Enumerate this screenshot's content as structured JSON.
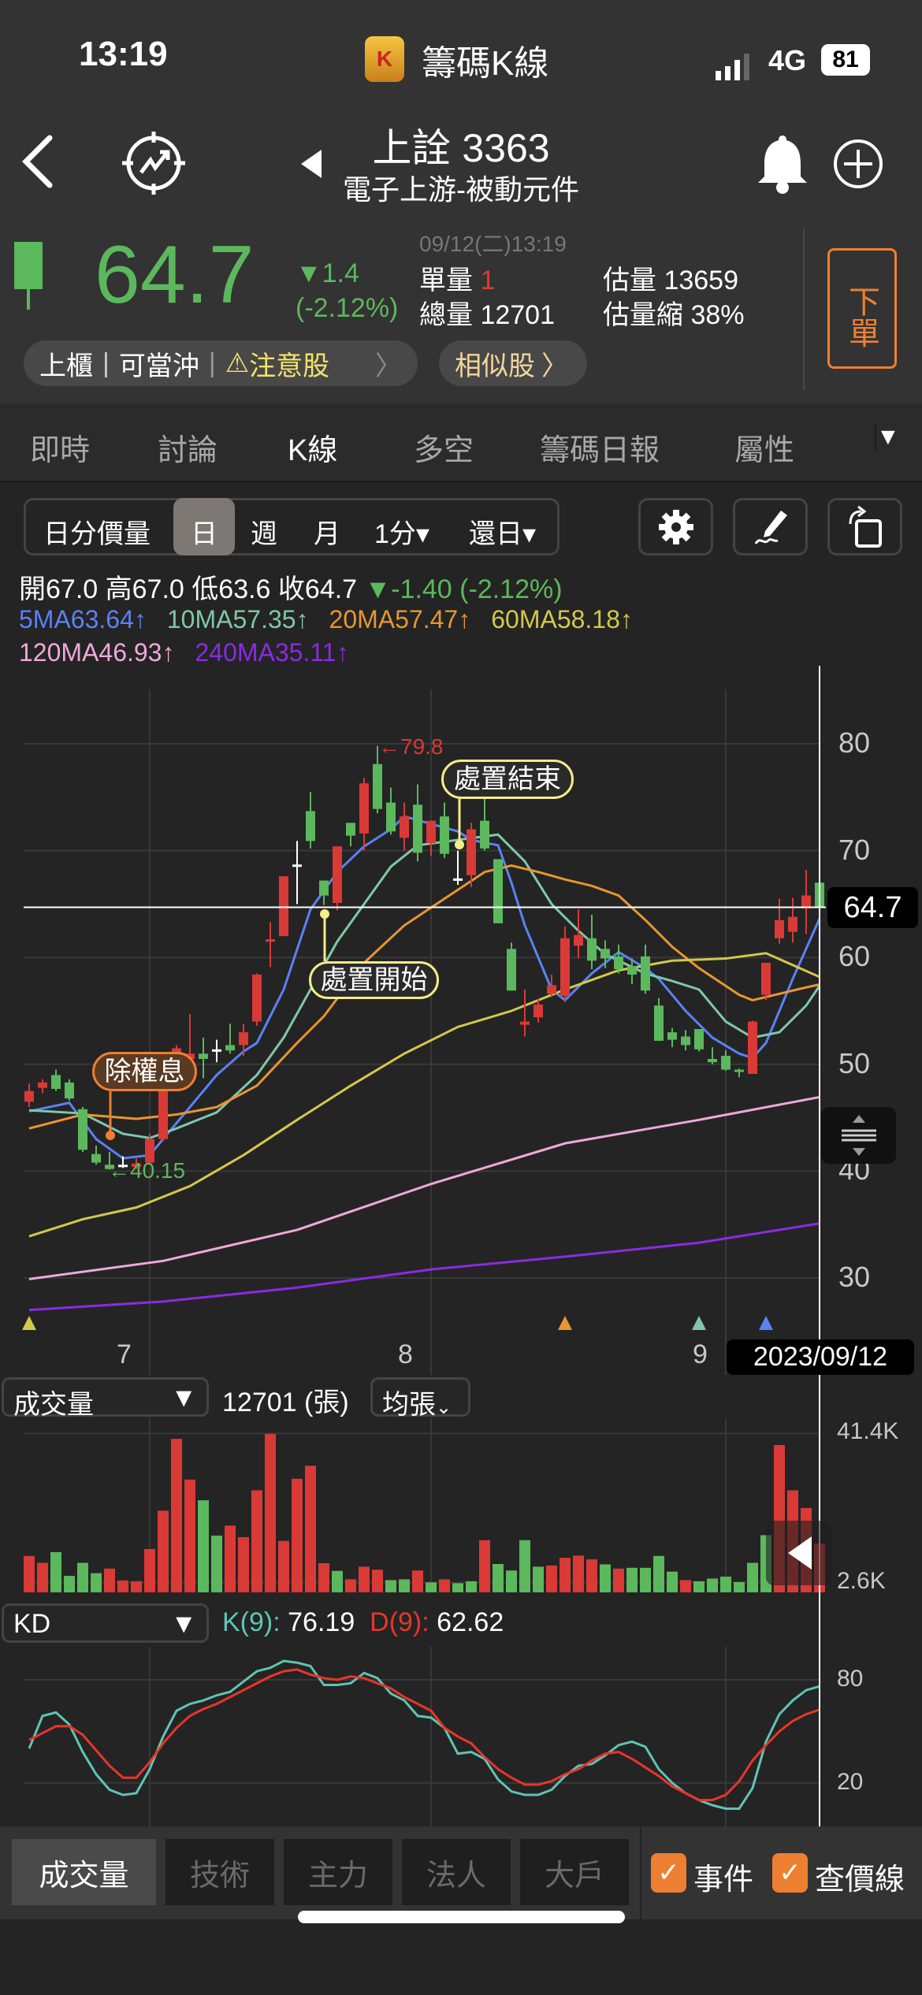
{
  "status": {
    "time": "13:19",
    "app_title": "籌碼K線",
    "network": "4G",
    "battery": "81"
  },
  "nav": {
    "title": "上詮 3363",
    "subtitle": "電子上游-被動元件"
  },
  "quote": {
    "price": "64.7",
    "change": "▼1.4",
    "change_pct": "(-2.12%)",
    "timestamp": "09/12(二)13:19",
    "single_vol_label": "單量",
    "single_vol": "1",
    "total_vol": "總量 12701",
    "est_vol": "估量 13659",
    "est_shrink": "估量縮 38%",
    "order_button": "下單"
  },
  "chips": {
    "market": "上櫃",
    "daytrade": "可當沖",
    "warning": "注意股",
    "similar": "相似股"
  },
  "tabs": [
    "即時",
    "討論",
    "K線",
    "多空",
    "籌碼日報",
    "屬性"
  ],
  "toolbar": {
    "segments": [
      "日分價量",
      "日",
      "週",
      "月",
      "1分▾",
      "還日▾"
    ],
    "active": 1
  },
  "ohlc": {
    "open": "開67.0",
    "high": "高67.0",
    "low": "低63.6",
    "close": "收64.7",
    "change": "▼-1.40 (-2.12%)"
  },
  "ma_labels": [
    {
      "text": "5MA63.64↑",
      "color": "#5a82f5"
    },
    {
      "text": "10MA57.35↑",
      "color": "#7ec8a8"
    },
    {
      "text": "20MA57.47↑",
      "color": "#e8962e"
    },
    {
      "text": "60MA58.18↑",
      "color": "#d4c84a"
    },
    {
      "text": "120MA46.93↑",
      "color": "#f0a8d8"
    },
    {
      "text": "240MA35.11↑",
      "color": "#8a2be2"
    }
  ],
  "colors": {
    "up": "#d93a36",
    "down": "#5cb85c",
    "k": "#5fc4b4",
    "d": "#e8352a",
    "accent": "#ee7f30"
  },
  "chart_data": {
    "type": "candlestick",
    "price_axis": {
      "ticks": [
        "80",
        "70",
        "60",
        "50",
        "40",
        "30"
      ],
      "range": [
        27,
        84
      ]
    },
    "month_labels": [
      "7",
      "8",
      "9"
    ],
    "month_index": [
      9,
      30,
      52
    ],
    "current_price_label": "64.7",
    "current_price": 64.7,
    "current_date": "2023/09/12",
    "annotations": {
      "high": "←79.8",
      "low": "←40.15",
      "dispose_end": "處置結束",
      "dispose_start": "處置開始",
      "ex_dividend": "除權息"
    },
    "candles": [
      [
        46.5,
        48.2,
        46,
        47.5
      ],
      [
        47.8,
        48.6,
        47.3,
        48.3
      ],
      [
        49,
        49.5,
        47.5,
        47.7
      ],
      [
        48.3,
        48.6,
        46.6,
        46.8
      ],
      [
        45.8,
        46,
        41.8,
        42
      ],
      [
        41.6,
        42.4,
        40.6,
        40.8
      ],
      [
        40.6,
        41.8,
        40.15,
        40.2
      ],
      [
        40.6,
        41.4,
        40.3,
        40.6
      ],
      [
        40.4,
        41.2,
        40.2,
        40.7
      ],
      [
        40.8,
        43.5,
        40.6,
        43
      ],
      [
        43,
        48,
        42.8,
        47.8
      ],
      [
        51.1,
        51.8,
        50.6,
        51.5
      ],
      [
        50.5,
        54.7,
        50.2,
        51
      ],
      [
        51,
        52.5,
        48.7,
        50.5
      ],
      [
        51.4,
        52.3,
        50.2,
        51.4
      ],
      [
        51.8,
        53.8,
        51,
        51.3
      ],
      [
        51.8,
        53.8,
        50.8,
        53
      ],
      [
        54,
        58.5,
        53.6,
        58.4
      ],
      [
        61.5,
        63.3,
        59.1,
        61.7
      ],
      [
        62,
        67.6,
        62,
        67.6
      ],
      [
        68.7,
        70.9,
        65,
        68.7
      ],
      [
        73.7,
        75.5,
        70.2,
        70.9
      ],
      [
        67.2,
        67.2,
        64.9,
        65.8
      ],
      [
        65.1,
        70.4,
        64.4,
        70.4
      ],
      [
        72.6,
        72.6,
        70.4,
        71.4
      ],
      [
        71.6,
        76.8,
        70,
        76.3
      ],
      [
        78.1,
        79.8,
        73.5,
        73.9
      ],
      [
        74.5,
        75.9,
        71.5,
        71.8
      ],
      [
        71.2,
        74.5,
        70,
        73.2
      ],
      [
        74.3,
        76.2,
        69,
        69.8
      ],
      [
        70.7,
        72.8,
        69.5,
        72.8
      ],
      [
        73.2,
        74.5,
        69.3,
        69.7
      ],
      [
        67.4,
        70,
        66.8,
        67.4
      ],
      [
        67.7,
        72.6,
        66.6,
        72
      ],
      [
        72.8,
        76,
        70,
        70.2
      ],
      [
        69.2,
        69.2,
        63.2,
        63.2
      ],
      [
        60.8,
        61.4,
        56.9,
        56.9
      ],
      [
        53.7,
        57,
        52.6,
        54
      ],
      [
        54.4,
        56.1,
        53.9,
        55.6
      ],
      [
        56.6,
        58.4,
        56.3,
        57.4
      ],
      [
        56.4,
        62.9,
        55.8,
        61.8
      ],
      [
        61.1,
        64.5,
        59.9,
        62.1
      ],
      [
        61.8,
        64,
        58.9,
        59.7
      ],
      [
        60.8,
        61.6,
        59,
        59.9
      ],
      [
        60.1,
        61.2,
        58.5,
        58.9
      ],
      [
        59.2,
        59.9,
        57.5,
        58.4
      ],
      [
        60.1,
        61.2,
        56.6,
        56.9
      ],
      [
        55.5,
        56.2,
        52.2,
        52.2
      ],
      [
        53,
        53.4,
        51.6,
        52.3
      ],
      [
        52.6,
        53.2,
        51.3,
        51.8
      ],
      [
        53.3,
        53.3,
        51.2,
        51.4
      ],
      [
        50.5,
        51.6,
        50,
        50.2
      ],
      [
        50.8,
        51.3,
        49.4,
        49.5
      ],
      [
        49.5,
        49.6,
        48.8,
        49.3
      ],
      [
        49.1,
        54.1,
        49.1,
        54
      ],
      [
        56.5,
        59.5,
        56,
        59.5
      ],
      [
        61.8,
        65.5,
        61.3,
        63.5
      ],
      [
        62.4,
        65.6,
        61.4,
        63.8
      ],
      [
        64.6,
        68.2,
        62.2,
        65.8
      ],
      [
        67,
        67,
        63.6,
        64.7
      ]
    ],
    "ma": [
      {
        "name": "5MA",
        "color": "#5a82f5",
        "points": [
          [
            0,
            45.6
          ],
          [
            3,
            46.4
          ],
          [
            5,
            43
          ],
          [
            7,
            41.2
          ],
          [
            9,
            41.5
          ],
          [
            11,
            44.5
          ],
          [
            14,
            49
          ],
          [
            16,
            51.2
          ],
          [
            17,
            52
          ],
          [
            19,
            57
          ],
          [
            21,
            64.5
          ],
          [
            23,
            68
          ],
          [
            25,
            70.4
          ],
          [
            27,
            72
          ],
          [
            28,
            73.2
          ],
          [
            30,
            72.5
          ],
          [
            32,
            71.8
          ],
          [
            33,
            71
          ],
          [
            35,
            70.5
          ],
          [
            36,
            67
          ],
          [
            37,
            63
          ],
          [
            39,
            57
          ],
          [
            40,
            56
          ],
          [
            42,
            58.5
          ],
          [
            44,
            60.5
          ],
          [
            46,
            59
          ],
          [
            47,
            58
          ],
          [
            49,
            55
          ],
          [
            51,
            52.5
          ],
          [
            53,
            51
          ],
          [
            54,
            50.6
          ],
          [
            55,
            52
          ],
          [
            57,
            58
          ],
          [
            59,
            63.64
          ]
        ]
      },
      {
        "name": "10MA",
        "color": "#7ec8a8",
        "points": [
          [
            0,
            45.7
          ],
          [
            4,
            45.4
          ],
          [
            7,
            43.5
          ],
          [
            9,
            43.1
          ],
          [
            11,
            44
          ],
          [
            14,
            45.5
          ],
          [
            17,
            49
          ],
          [
            19,
            52.5
          ],
          [
            21,
            57
          ],
          [
            23,
            61.5
          ],
          [
            25,
            65
          ],
          [
            27,
            68.5
          ],
          [
            29,
            70.5
          ],
          [
            32,
            71
          ],
          [
            35,
            71.5
          ],
          [
            37,
            69
          ],
          [
            39,
            65
          ],
          [
            41,
            62.5
          ],
          [
            43,
            60.3
          ],
          [
            46,
            58.5
          ],
          [
            48,
            57.8
          ],
          [
            50,
            57
          ],
          [
            52,
            54
          ],
          [
            54,
            52.5
          ],
          [
            56,
            53
          ],
          [
            58,
            55.5
          ],
          [
            59,
            57.35
          ]
        ]
      },
      {
        "name": "20MA",
        "color": "#e8962e",
        "points": [
          [
            0,
            44
          ],
          [
            4,
            45.3
          ],
          [
            8,
            44.9
          ],
          [
            11,
            45.3
          ],
          [
            14,
            46
          ],
          [
            17,
            48
          ],
          [
            20,
            52
          ],
          [
            22,
            54.5
          ],
          [
            25,
            59.5
          ],
          [
            28,
            63
          ],
          [
            31,
            65.5
          ],
          [
            34,
            68
          ],
          [
            36,
            68.6
          ],
          [
            38,
            68
          ],
          [
            40,
            67.3
          ],
          [
            42,
            66.7
          ],
          [
            44,
            65.8
          ],
          [
            46,
            63.5
          ],
          [
            48,
            61
          ],
          [
            50,
            59
          ],
          [
            53,
            56.5
          ],
          [
            54,
            56
          ],
          [
            56,
            56.6
          ],
          [
            58,
            57.2
          ],
          [
            59,
            57.47
          ]
        ]
      },
      {
        "name": "60MA",
        "color": "#d4c84a",
        "points": [
          [
            0,
            33.9
          ],
          [
            4,
            35.5
          ],
          [
            8,
            36.6
          ],
          [
            12,
            38.6
          ],
          [
            16,
            41.5
          ],
          [
            20,
            44.8
          ],
          [
            24,
            48
          ],
          [
            28,
            51
          ],
          [
            32,
            53.5
          ],
          [
            36,
            55
          ],
          [
            40,
            57
          ],
          [
            44,
            58.8
          ],
          [
            48,
            59.7
          ],
          [
            52,
            59.9
          ],
          [
            55,
            60.4
          ],
          [
            59,
            58.18
          ]
        ]
      },
      {
        "name": "120MA",
        "color": "#f0a8d8",
        "points": [
          [
            0,
            29.9
          ],
          [
            10,
            31.6
          ],
          [
            20,
            34.5
          ],
          [
            30,
            38.8
          ],
          [
            40,
            42.6
          ],
          [
            50,
            44.8
          ],
          [
            59,
            46.93
          ]
        ]
      },
      {
        "name": "240MA",
        "color": "#8a2be2",
        "points": [
          [
            0,
            27
          ],
          [
            10,
            27.8
          ],
          [
            20,
            29.1
          ],
          [
            30,
            30.8
          ],
          [
            40,
            32
          ],
          [
            50,
            33.3
          ],
          [
            59,
            35.11
          ]
        ]
      }
    ],
    "event_markers": [
      {
        "index": 0,
        "color": "#d4c84a"
      },
      {
        "index": 40,
        "color": "#e8962e"
      },
      {
        "index": 50,
        "color": "#7ec8a8"
      },
      {
        "index": 55,
        "color": "#5a82f5"
      }
    ],
    "volume": {
      "label": "成交量",
      "total": "12701 (張)",
      "unit_select": "均張",
      "ticks": [
        "41.4K",
        "2.6K"
      ],
      "values": [
        9.5,
        7.7,
        10.5,
        4.3,
        7.7,
        5,
        6.2,
        3.1,
        2.9,
        11.3,
        21.3,
        40,
        29.4,
        24,
        14.8,
        17.4,
        14.4,
        26.6,
        41.3,
        13.4,
        29.6,
        33,
        7.6,
        5.6,
        3.4,
        6.7,
        5.9,
        3.2,
        3.4,
        5.7,
        2.6,
        3.4,
        2.4,
        2.9,
        13.6,
        7.4,
        5.7,
        13.6,
        6.7,
        7,
        9,
        9.6,
        8.6,
        7.3,
        6.2,
        6.4,
        6.4,
        9.5,
        5.4,
        3.2,
        2.9,
        3.6,
        4.1,
        2.7,
        7.7,
        14.9,
        38.4,
        26.6,
        22,
        12.7
      ],
      "dirs": "uuddddu uuuuuudduuuuuuuuduuuddududdudddduuuududdddudddddduuuuud"
    },
    "kd": {
      "label": "KD",
      "k_label": "K(9):",
      "k_value": "76.19",
      "d_label": "D(9):",
      "d_value": "62.62",
      "ticks": [
        "80",
        "20"
      ],
      "k": [
        40,
        59,
        61,
        54,
        38,
        25,
        16,
        13,
        14,
        28,
        47,
        62,
        66,
        68,
        71,
        73,
        79,
        85,
        87,
        91,
        90,
        88,
        77,
        77,
        78,
        84,
        81,
        72,
        68,
        59,
        58,
        52,
        37,
        38,
        34,
        22,
        15,
        13,
        13,
        16,
        24,
        30,
        31,
        36,
        42,
        44,
        41,
        28,
        20,
        14,
        10,
        7,
        5,
        5,
        17,
        44,
        60,
        68,
        74,
        76.19
      ],
      "d": [
        45,
        49,
        53,
        53,
        48,
        39,
        30,
        23,
        23,
        32,
        43,
        52,
        59,
        63,
        66,
        70,
        74,
        78,
        82,
        85,
        86,
        83,
        81,
        80,
        82,
        81,
        78,
        75,
        70,
        66,
        62,
        52,
        47,
        43,
        35,
        28,
        23,
        19,
        19,
        21,
        25,
        28,
        33,
        37,
        38,
        34,
        29,
        24,
        18,
        14,
        10,
        10,
        13,
        21,
        33,
        42,
        50,
        56,
        60,
        62.62
      ]
    }
  },
  "bottom_tabs": [
    "成交量",
    "技術",
    "主力",
    "法人",
    "大戶"
  ],
  "checkboxes": [
    {
      "label": "事件",
      "checked": true
    },
    {
      "label": "查價線",
      "checked": true
    }
  ]
}
